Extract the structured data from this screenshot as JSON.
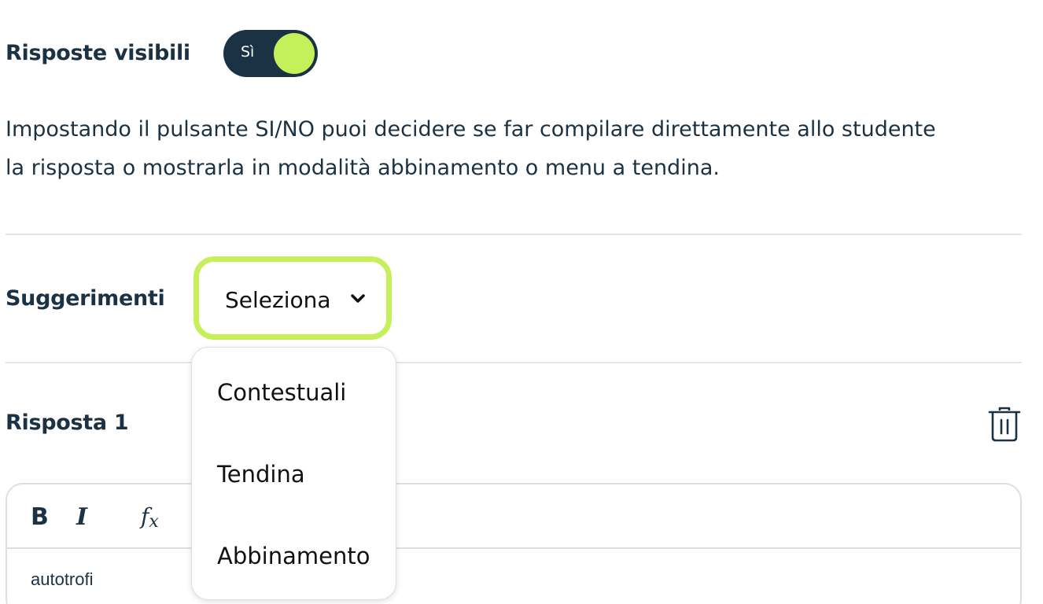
{
  "visibility": {
    "label": "Risposte visibili",
    "toggle_text": "Sì",
    "toggle_on": true
  },
  "description": {
    "line1": "Impostando il pulsante SI/NO puoi decidere se far compilare direttamente allo studente",
    "line2": "la risposta o mostrarla in modalità abbinamento o menu a tendina."
  },
  "hints": {
    "label": "Suggerimenti",
    "selected": "Seleziona",
    "options": [
      "Contestuali",
      "Tendina",
      "Abbinamento"
    ]
  },
  "answer": {
    "label": "Risposta 1",
    "toolbar": {
      "bold": "B",
      "italic": "I",
      "formula": "fx"
    },
    "content": "autotrofi"
  },
  "colors": {
    "accent": "#c6f05a",
    "navy": "#1b3244",
    "divider": "#e3e6e9"
  },
  "icons": {
    "dropdown": "chevron-down-icon",
    "delete": "trash-icon"
  }
}
